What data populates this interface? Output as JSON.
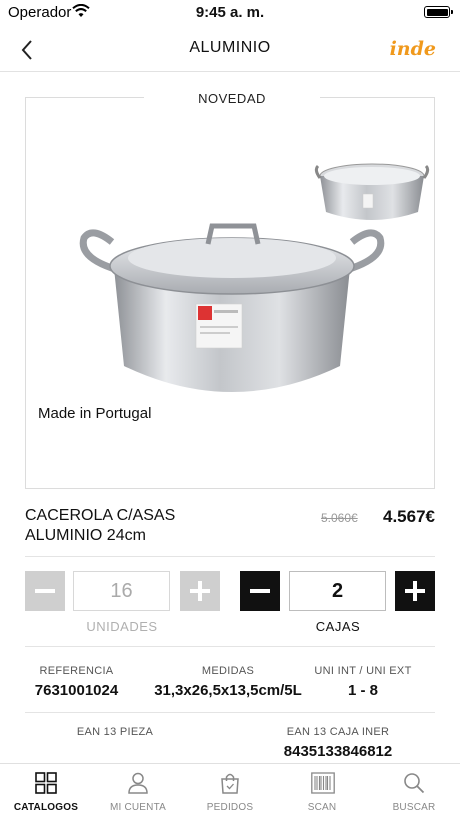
{
  "status": {
    "carrier": "Operador",
    "time": "9:45 a. m."
  },
  "nav": {
    "title": "ALUMINIO",
    "brand": "inde"
  },
  "product": {
    "badge": "NOVEDAD",
    "origin": "Made in Portugal",
    "name_line1": "CACEROLA C/ASAS",
    "name_line2": "ALUMINIO 24cm",
    "old_price": "5.060€",
    "price": "4.567€"
  },
  "order": {
    "units_value": "16",
    "units_label": "UNIDADES",
    "boxes_value": "2",
    "boxes_label": "CAJAS"
  },
  "specs": {
    "ref_label": "REFERENCIA",
    "ref_value": "7631001024",
    "size_label": "MEDIDAS",
    "size_value": "31,3x26,5x13,5cm/5L",
    "pack_label": "UNI INT / UNI EXT",
    "pack_value": "1 - 8",
    "ean_piece_label": "EAN 13 PIEZA",
    "ean_box_label": "EAN 13 CAJA INER",
    "ean_box_value": "8435133846812"
  },
  "tabs": [
    {
      "label": "CATALOGOS",
      "icon": "grid-icon",
      "selected": true
    },
    {
      "label": "MI CUENTA",
      "icon": "user-icon",
      "selected": false
    },
    {
      "label": "PEDIDOS",
      "icon": "bag-icon",
      "selected": false
    },
    {
      "label": "SCAN",
      "icon": "barcode-icon",
      "selected": false
    },
    {
      "label": "BUSCAR",
      "icon": "search-icon",
      "selected": false
    }
  ],
  "colors": {
    "brand": "#f0991c",
    "active": "#111111",
    "disabled": "#cfcfcf"
  }
}
